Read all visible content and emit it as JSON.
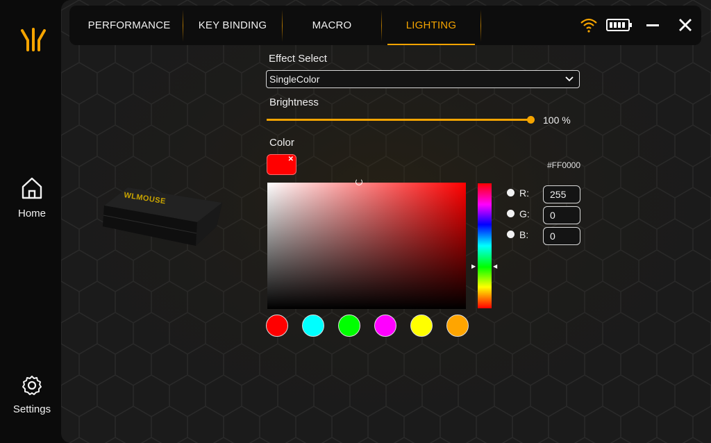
{
  "sidebar": {
    "logo": "yellow-claw-logo",
    "items": [
      {
        "label": "Home",
        "icon": "home-icon"
      },
      {
        "label": "Settings",
        "icon": "gear-icon"
      }
    ]
  },
  "header": {
    "tabs": [
      {
        "label": "PERFORMANCE",
        "active": false
      },
      {
        "label": "KEY BINDING",
        "active": false
      },
      {
        "label": "MACRO",
        "active": false
      },
      {
        "label": "LIGHTING",
        "active": true
      }
    ],
    "icons": [
      "wifi-icon",
      "battery-icon",
      "minimize-icon",
      "close-icon"
    ]
  },
  "device": {
    "brand_text": "WLMOUSE"
  },
  "lighting": {
    "effect_label": "Effect Select",
    "effect_value": "SingleColor",
    "brightness_label": "Brightness",
    "brightness_value": "100 %",
    "brightness_level": 1.0,
    "color_label": "Color",
    "hex": "#FF0000",
    "rgb": {
      "r_label": "R:",
      "r": "255",
      "g_label": "G:",
      "g": "0",
      "b_label": "B:",
      "b": "0"
    },
    "presets": [
      "#ff0000",
      "#00ffff",
      "#00ff00",
      "#ff00ff",
      "#ffff00",
      "#ffa500"
    ]
  },
  "colors": {
    "accent": "#f5a400",
    "background": "#1b1b1b",
    "topbar": "#0d0d0d"
  }
}
